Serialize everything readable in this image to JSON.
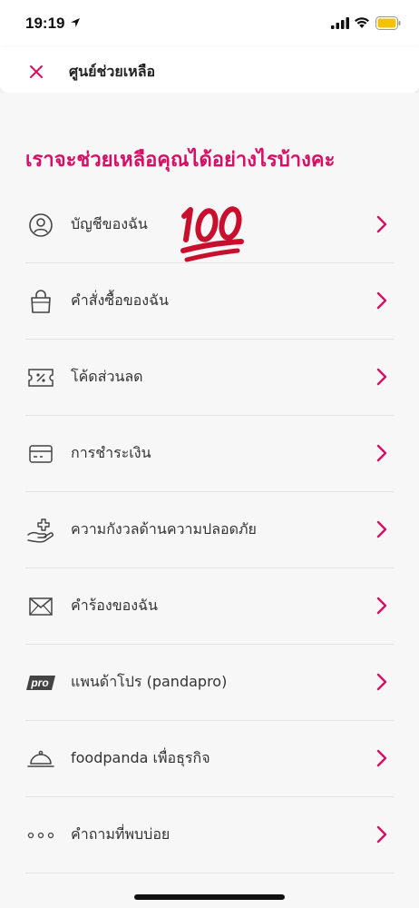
{
  "status_bar": {
    "time": "19:19",
    "battery_color": "#f4c300"
  },
  "header": {
    "title": "ศูนย์ช่วยเหลือ"
  },
  "main": {
    "title": "เราจะช่วยเหลือคุณได้อย่างไรบ้างคะ",
    "accent_color": "#d70f64",
    "items": [
      {
        "label": "บัญชีของฉัน",
        "icon": "user-circle-icon"
      },
      {
        "label": "คำสั่งซื้อของฉัน",
        "icon": "shopping-bag-icon"
      },
      {
        "label": "โค้ดส่วนลด",
        "icon": "voucher-icon"
      },
      {
        "label": "การชำระเงิน",
        "icon": "credit-card-icon"
      },
      {
        "label": "ความกังวลด้านความปลอดภัย",
        "icon": "safety-hand-icon"
      },
      {
        "label": "คำร้องของฉัน",
        "icon": "envelope-icon"
      },
      {
        "label": "แพนด้าโปร (pandapro)",
        "icon": "pro-badge-icon"
      },
      {
        "label": "foodpanda เพื่อธุรกิจ",
        "icon": "food-cloche-icon"
      },
      {
        "label": "คำถามที่พบบ่อย",
        "icon": "more-dots-icon"
      }
    ],
    "pro_badge_text": "pro"
  }
}
